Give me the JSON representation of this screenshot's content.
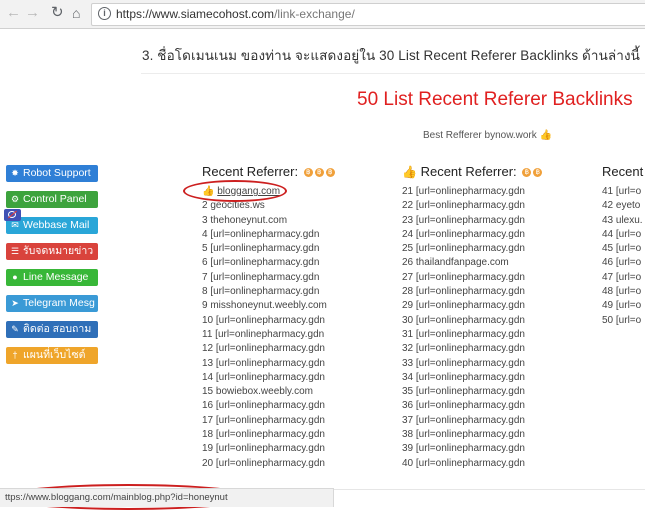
{
  "browser": {
    "url_host": "https://www.siamecohost.com",
    "url_path": "/link-exchange/",
    "status_url": "ttps://www.bloggang.com/mainblog.php?id=honeynut"
  },
  "page": {
    "section_heading": "3. ชื่อโดเมนเนม ของท่าน จะแสดงอยู่ใน 30 List Recent Referer Backlinks ด้านล่างนี้",
    "panel_title": "50 List Recent Referer Backlinks",
    "best_referrer": "Best Refferer bynow.work"
  },
  "sidebar": {
    "items": [
      {
        "label": "Robot Support",
        "icon": "cog-icon",
        "color": "#2f7fd6"
      },
      {
        "label": "Control Panel",
        "icon": "settings-icon",
        "color": "#3da33d"
      },
      {
        "label": "Webbase Mail",
        "icon": "mail-icon",
        "color": "#29a6d8"
      },
      {
        "label": "รับจดหมายข่าว",
        "icon": "newsletter-icon",
        "color": "#d9433c"
      },
      {
        "label": "Line Message",
        "icon": "chat-icon",
        "color": "#38b738"
      },
      {
        "label": "Telegram Mesg",
        "icon": "send-icon",
        "color": "#3a9ad6"
      },
      {
        "label": "ติดต่อ สอบถาม",
        "icon": "edit-icon",
        "color": "#2f6fb8"
      },
      {
        "label": "แผนที่เว็บไซต์",
        "icon": "sitemap-icon",
        "color": "#efa52a"
      }
    ]
  },
  "columns": [
    {
      "header": "Recent Referrer:",
      "items": [
        "bloggang.com",
        "2 geocities.ws",
        "3 thehoneynut.com",
        "4 [url=onlinepharmacy.gdn",
        "5 [url=onlinepharmacy.gdn",
        "6 [url=onlinepharmacy.gdn",
        "7 [url=onlinepharmacy.gdn",
        "8 [url=onlinepharmacy.gdn",
        "9 misshoneynut.weebly.com",
        "10 [url=onlinepharmacy.gdn",
        "11 [url=onlinepharmacy.gdn",
        "12 [url=onlinepharmacy.gdn",
        "13 [url=onlinepharmacy.gdn",
        "14 [url=onlinepharmacy.gdn",
        "15 bowiebox.weebly.com",
        "16 [url=onlinepharmacy.gdn",
        "17 [url=onlinepharmacy.gdn",
        "18 [url=onlinepharmacy.gdn",
        "19 [url=onlinepharmacy.gdn",
        "20 [url=onlinepharmacy.gdn"
      ]
    },
    {
      "header": "Recent Referrer:",
      "items": [
        "21 [url=onlinepharmacy.gdn",
        "22 [url=onlinepharmacy.gdn",
        "23 [url=onlinepharmacy.gdn",
        "24 [url=onlinepharmacy.gdn",
        "25 [url=onlinepharmacy.gdn",
        "26 thailandfanpage.com",
        "27 [url=onlinepharmacy.gdn",
        "28 [url=onlinepharmacy.gdn",
        "29 [url=onlinepharmacy.gdn",
        "30 [url=onlinepharmacy.gdn",
        "31 [url=onlinepharmacy.gdn",
        "32 [url=onlinepharmacy.gdn",
        "33 [url=onlinepharmacy.gdn",
        "34 [url=onlinepharmacy.gdn",
        "35 [url=onlinepharmacy.gdn",
        "36 [url=onlinepharmacy.gdn",
        "37 [url=onlinepharmacy.gdn",
        "38 [url=onlinepharmacy.gdn",
        "39 [url=onlinepharmacy.gdn",
        "40 [url=onlinepharmacy.gdn"
      ]
    },
    {
      "header": "Recent",
      "items": [
        "41 [url=o",
        "42 eyeto",
        "43 ulexu.",
        "44 [url=o",
        "45 [url=o",
        "46 [url=o",
        "47 [url=o",
        "48 [url=o",
        "49 [url=o",
        "50 [url=o"
      ]
    }
  ],
  "colors": {
    "panel_title": "#e02020",
    "annotation": "#cc1f1f",
    "coin": "#f0a03a"
  }
}
